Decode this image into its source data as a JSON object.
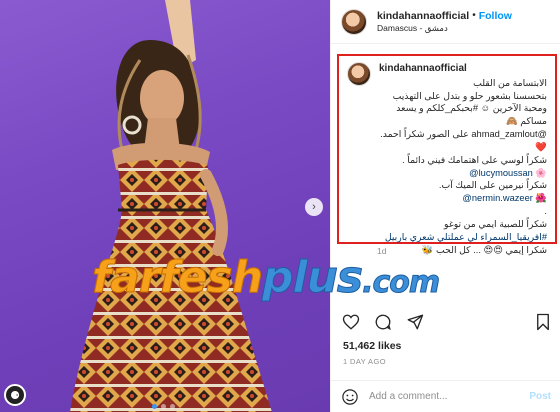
{
  "post": {
    "username": "kindahannaofficial",
    "follow_label": "Follow",
    "location": "Damascus - دمشق",
    "caption_username": "kindahannaofficial",
    "caption_lines": [
      "الابتسامة من القلب",
      "بتحسسنا بشعور حلو و بتدل على التهذيب",
      "ومحبة الآخرين ☺ #بحبكم_كلكم و يسعد",
      "مساكم 🙈",
      "@ahmad_zamlout على الصور شكراً احمد.",
      "❤️",
      "شكراً لوسي على اهتمامك فيني دائماً .",
      "@lucymoussan 🌸",
      "شكراً نيرمين على الميك آب.",
      "@nermin.wazeer 🌺",
      ".",
      "شكراً للصبية ايمي من توغو",
      "#افريقيا_السمراء لي عملتلي شعري باربيل",
      "شكرا إيمي 😍😍 ... كل الحب 🐝"
    ],
    "caption_age": "1d",
    "likes": "51,462 likes",
    "posted_ago": "1 DAY AGO",
    "comment_placeholder": "Add a comment...",
    "post_label": "Post"
  },
  "watermark": {
    "part1": "farfesh",
    "part2": "plus",
    "tld": ".com"
  },
  "icons": {
    "heart": "heart-icon",
    "comment": "comment-icon",
    "share": "share-icon",
    "save": "bookmark-icon",
    "emoji": "smile-icon",
    "next": "chevron-right-icon",
    "more": "more-icon"
  },
  "colors": {
    "accent": "#0095f6",
    "highlight_box": "#e0201f",
    "photo_bg": "#7a4ac4"
  }
}
